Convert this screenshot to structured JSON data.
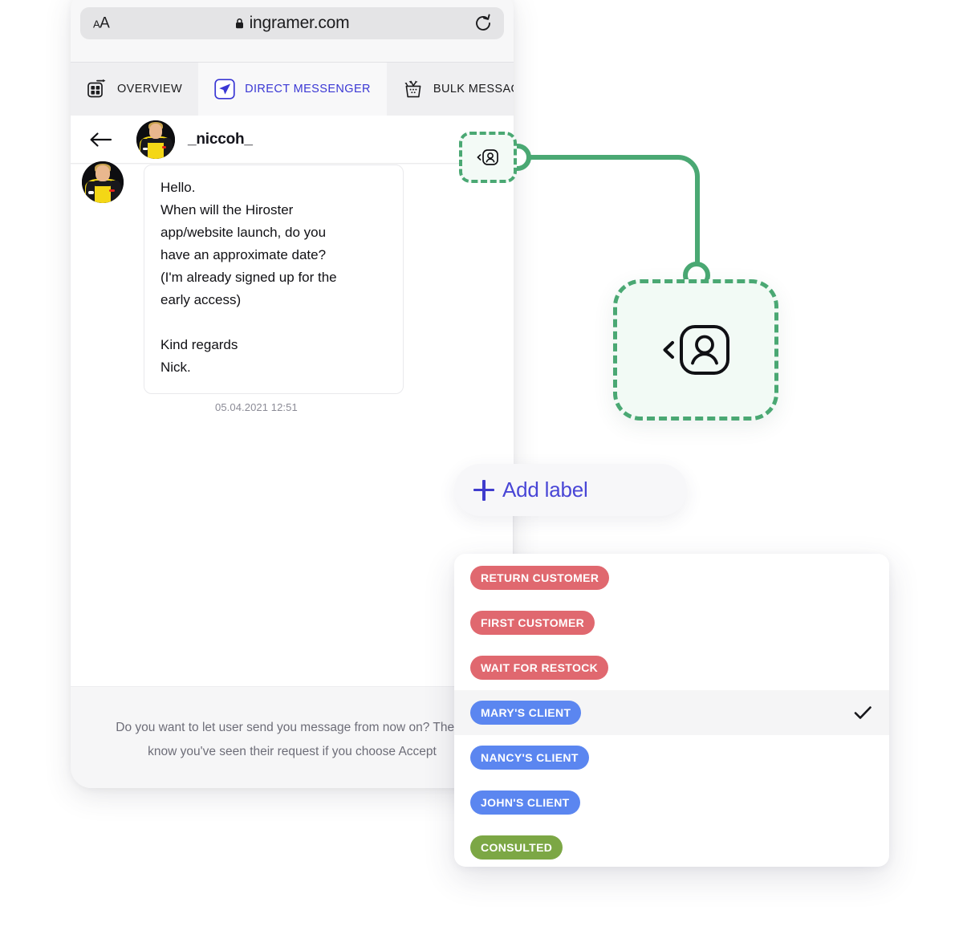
{
  "browser": {
    "text_size_button": "AA",
    "url": "ingramer.com",
    "lock_icon": "lock-icon",
    "reload_icon": "reload-icon"
  },
  "tabs": [
    {
      "label": "OVERVIEW",
      "icon": "grid-play-icon",
      "active": false
    },
    {
      "label": "DIRECT MESSENGER",
      "icon": "paper-plane-icon",
      "active": true
    },
    {
      "label": "BULK MESSAGING",
      "icon": "basket-arrows-icon",
      "active": false
    }
  ],
  "conversation": {
    "back_icon": "back-arrow-icon",
    "avatar_icon": "user-avatar",
    "username": "_niccoh_",
    "message": {
      "line1": "Hello.",
      "line2": "When will the Hiroster",
      "line3": "app/website launch, do you",
      "line4": "have an approximate date?",
      "line5": "(I'm already signed up for the",
      "line6": "early access)",
      "line7": "Kind regards",
      "line8": "Nick."
    },
    "timestamp": "05.04.2021 12:51"
  },
  "accept_footer": {
    "line1": "Do you want to let user send you message from now on? They'll",
    "line2": "know you've seen their request if you choose Accept"
  },
  "flow": {
    "accent_color": "#4aa873",
    "mini_node_icon": "assign-user-icon",
    "big_node_icon": "assign-user-icon"
  },
  "add_label": {
    "plus_icon": "plus-icon",
    "label": "Add label"
  },
  "labels_dropdown": {
    "check_icon": "check-icon",
    "items": [
      {
        "label": "RETURN CUSTOMER",
        "color": "#e0686f",
        "selected": false
      },
      {
        "label": "FIRST CUSTOMER",
        "color": "#e0686f",
        "selected": false
      },
      {
        "label": "WAIT FOR RESTOCK",
        "color": "#e0686f",
        "selected": false
      },
      {
        "label": "MARY'S CLIENT",
        "color": "#5b86f0",
        "selected": true
      },
      {
        "label": "NANCY'S CLIENT",
        "color": "#5b86f0",
        "selected": false
      },
      {
        "label": "JOHN'S CLIENT",
        "color": "#5b86f0",
        "selected": false
      },
      {
        "label": "CONSULTED",
        "color": "#7ca745",
        "selected": false
      }
    ]
  }
}
